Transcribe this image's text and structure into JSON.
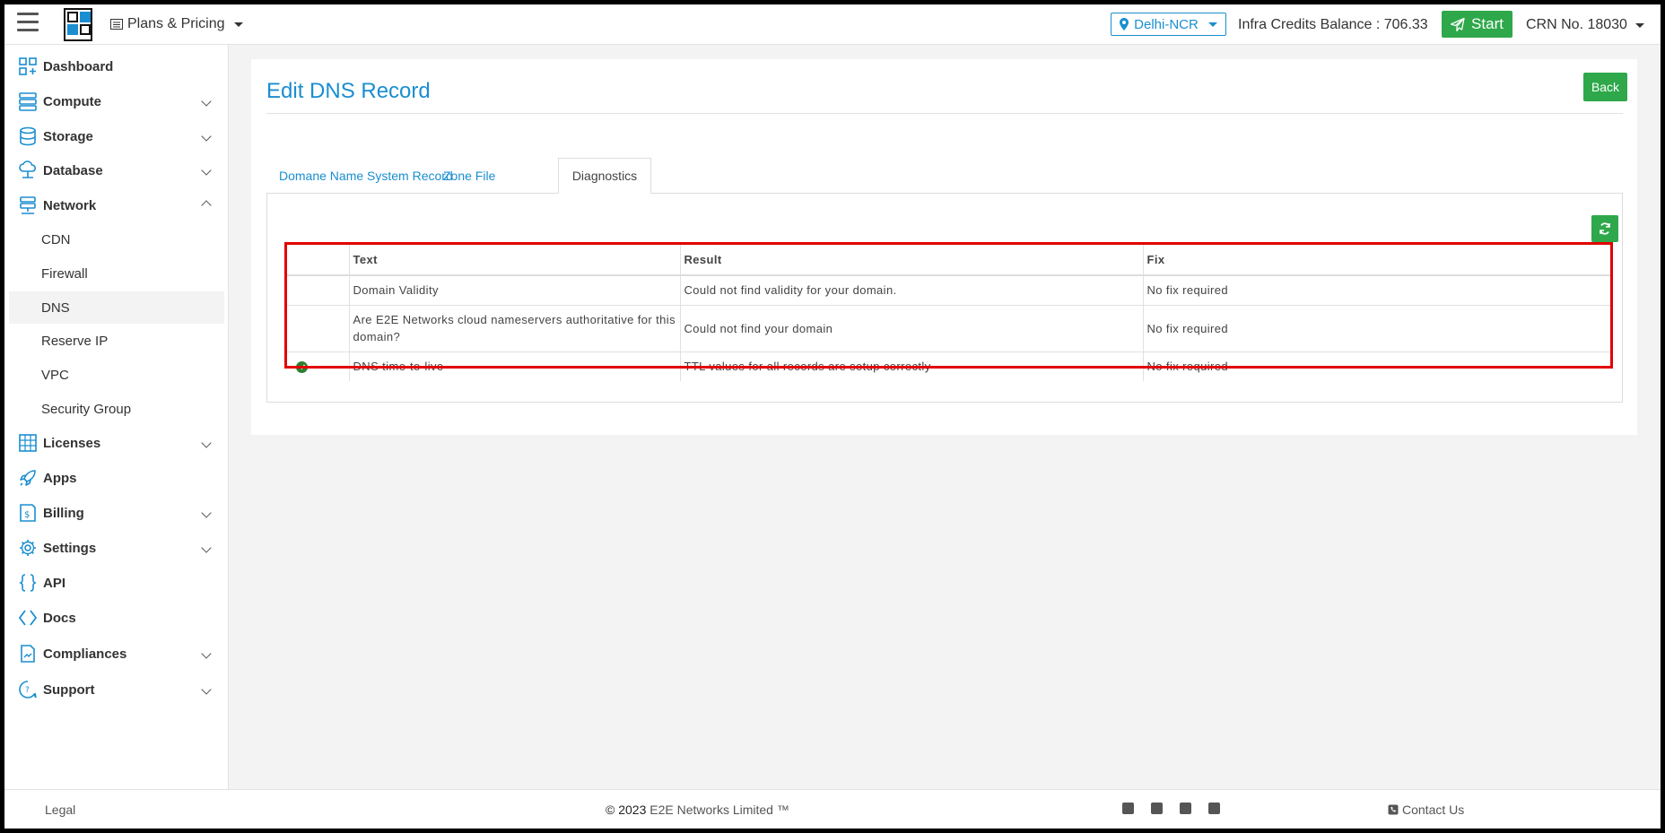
{
  "header": {
    "plans_label": "Plans & Pricing",
    "region": "Delhi-NCR",
    "credits": "Infra Credits Balance : 706.33",
    "start_label": "Start",
    "crn": "CRN No. 18030"
  },
  "sidebar": {
    "items": [
      {
        "label": "Dashboard"
      },
      {
        "label": "Compute"
      },
      {
        "label": "Storage"
      },
      {
        "label": "Database"
      },
      {
        "label": "Network"
      },
      {
        "label": "Licenses"
      },
      {
        "label": "Apps"
      },
      {
        "label": "Billing"
      },
      {
        "label": "Settings"
      },
      {
        "label": "API"
      },
      {
        "label": "Docs"
      },
      {
        "label": "Compliances"
      },
      {
        "label": "Support"
      }
    ],
    "network_sub": [
      {
        "label": "CDN"
      },
      {
        "label": "Firewall"
      },
      {
        "label": "DNS"
      },
      {
        "label": "Reserve IP"
      },
      {
        "label": "VPC"
      },
      {
        "label": "Security Group"
      }
    ]
  },
  "main": {
    "title": "Edit DNS Record",
    "back_label": "Back",
    "tabs": [
      {
        "label": "Domane Name System Record"
      },
      {
        "label": "Zone File"
      },
      {
        "label": "Diagnostics"
      }
    ],
    "table": {
      "headers": [
        "",
        "Text",
        "Result",
        "Fix"
      ],
      "rows": [
        {
          "status": "",
          "text": "Domain Validity",
          "result": "Could not find validity for your domain.",
          "fix": "No fix required"
        },
        {
          "status": "",
          "text": "Are E2E Networks cloud nameservers authoritative for this domain?",
          "result": "Could not find your domain",
          "fix": "No fix required"
        },
        {
          "status": "check",
          "text": "DNS time-to-live",
          "result": "TTL values for all records are setup correctly",
          "fix": "No fix required"
        }
      ]
    }
  },
  "footer": {
    "legal": "Legal",
    "copyright": "© 2023",
    "company": "E2E Networks Limited ™",
    "contact": "Contact Us"
  },
  "colors": {
    "accent": "#1a8ed0",
    "green": "#2ea84a",
    "highlight": "#e20000"
  }
}
